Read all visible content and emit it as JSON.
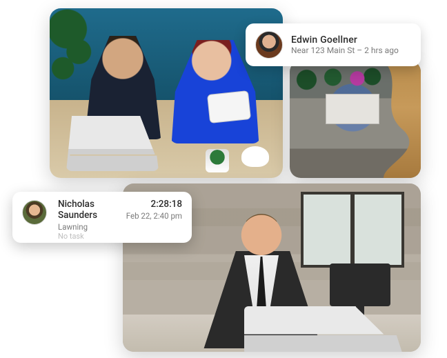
{
  "user_near_card": {
    "name": "Edwin Goellner",
    "sub": "Near 123 Main St – 2 hrs ago"
  },
  "task_card": {
    "name": "Nicholas Saunders",
    "task": "Lawning",
    "no_task": "No task",
    "time": "2:28:18",
    "date": "Feb 22, 2:40 pm"
  }
}
